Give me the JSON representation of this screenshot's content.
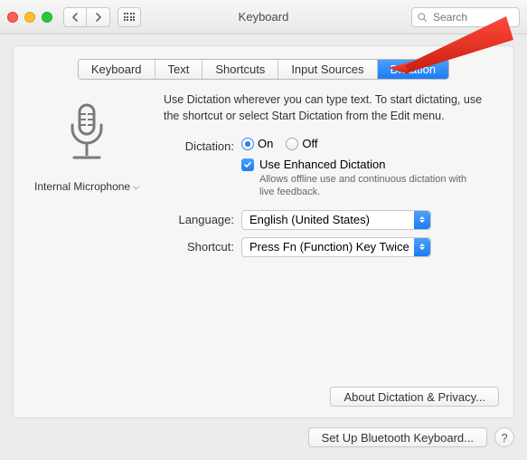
{
  "window": {
    "title": "Keyboard"
  },
  "search": {
    "placeholder": "Search"
  },
  "tabs": [
    {
      "label": "Keyboard",
      "selected": false
    },
    {
      "label": "Text",
      "selected": false
    },
    {
      "label": "Shortcuts",
      "selected": false
    },
    {
      "label": "Input Sources",
      "selected": false
    },
    {
      "label": "Dictation",
      "selected": true
    }
  ],
  "mic": {
    "label": "Internal Microphone"
  },
  "intro": "Use Dictation wherever you can type text. To start dictating, use the shortcut or select Start Dictation from the Edit menu.",
  "dictation": {
    "label": "Dictation:",
    "on": "On",
    "off": "Off",
    "selected": "On",
    "enhanced_label": "Use Enhanced Dictation",
    "enhanced_checked": true,
    "enhanced_desc": "Allows offline use and continuous dictation with live feedback."
  },
  "language": {
    "label": "Language:",
    "value": "English (United States)"
  },
  "shortcut": {
    "label": "Shortcut:",
    "value": "Press Fn (Function) Key Twice"
  },
  "buttons": {
    "about": "About Dictation & Privacy...",
    "bluetooth": "Set Up Bluetooth Keyboard...",
    "help": "?"
  }
}
